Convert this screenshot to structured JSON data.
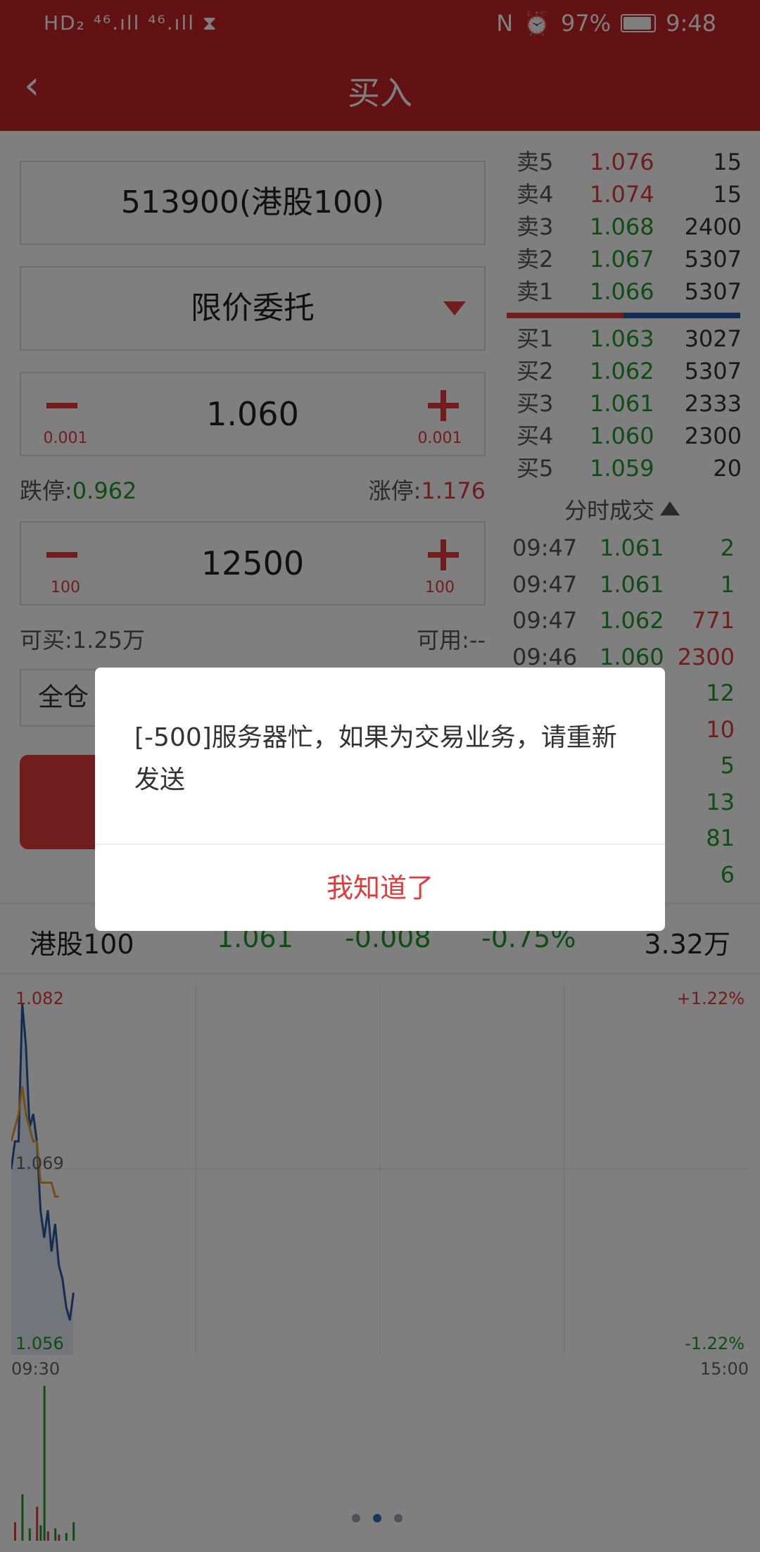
{
  "status_bar": {
    "left_indicators": "HD₂ ⁴⁶.ıll ⁴⁶.ıll ⧗",
    "nfc": "N",
    "alarm": "⏰",
    "battery_text": "97%",
    "time": "9:48"
  },
  "header": {
    "back_glyph": "‹",
    "title": "买入"
  },
  "form": {
    "stock": "513900(港股100)",
    "order_type": "限价委托",
    "price": {
      "value": "1.060",
      "step_minus": "0.001",
      "step_plus": "0.001"
    },
    "limit_down_label": "跌停:",
    "limit_down_value": "0.962",
    "limit_up_label": "涨停:",
    "limit_up_value": "1.176",
    "quantity": {
      "value": "12500",
      "step_minus": "100",
      "step_plus": "100"
    },
    "can_buy": "可买:1.25万",
    "available": "可用:--",
    "position_option": "全仓"
  },
  "order_book": {
    "asks": [
      {
        "label": "卖5",
        "price": "1.076",
        "vol": "15",
        "color": "#e23a3a"
      },
      {
        "label": "卖4",
        "price": "1.074",
        "vol": "15",
        "color": "#e23a3a"
      },
      {
        "label": "卖3",
        "price": "1.068",
        "vol": "2400",
        "color": "#1f9a2a"
      },
      {
        "label": "卖2",
        "price": "1.067",
        "vol": "5307",
        "color": "#1f9a2a"
      },
      {
        "label": "卖1",
        "price": "1.066",
        "vol": "5307",
        "color": "#1f9a2a"
      }
    ],
    "bids": [
      {
        "label": "买1",
        "price": "1.063",
        "vol": "3027",
        "color": "#1f9a2a"
      },
      {
        "label": "买2",
        "price": "1.062",
        "vol": "5307",
        "color": "#1f9a2a"
      },
      {
        "label": "买3",
        "price": "1.061",
        "vol": "2333",
        "color": "#1f9a2a"
      },
      {
        "label": "买4",
        "price": "1.060",
        "vol": "2300",
        "color": "#1f9a2a"
      },
      {
        "label": "买5",
        "price": "1.059",
        "vol": "20",
        "color": "#1f9a2a"
      }
    ]
  },
  "ticks": {
    "title": "分时成交",
    "rows": [
      {
        "time": "09:47",
        "price": "1.061",
        "vol": "2",
        "vol_color": "#1f9a2a"
      },
      {
        "time": "09:47",
        "price": "1.061",
        "vol": "1",
        "vol_color": "#1f9a2a"
      },
      {
        "time": "09:47",
        "price": "1.062",
        "vol": "771",
        "vol_color": "#e23a3a"
      },
      {
        "time": "09:46",
        "price": "1.060",
        "vol": "2300",
        "vol_color": "#e23a3a"
      },
      {
        "time": "",
        "price": "",
        "vol": "12",
        "vol_color": "#1f9a2a"
      },
      {
        "time": "",
        "price": "",
        "vol": "10",
        "vol_color": "#e23a3a"
      },
      {
        "time": "",
        "price": "",
        "vol": "5",
        "vol_color": "#1f9a2a"
      },
      {
        "time": "",
        "price": "",
        "vol": "13",
        "vol_color": "#1f9a2a"
      },
      {
        "time": "",
        "price": "",
        "vol": "81",
        "vol_color": "#1f9a2a"
      },
      {
        "time": "",
        "price": "",
        "vol": "6",
        "vol_color": "#1f9a2a"
      }
    ]
  },
  "quote": {
    "name": "港股100",
    "price": "1.061",
    "change": "-0.008",
    "change_pct": "-0.75%",
    "amount": "3.32万"
  },
  "chart_data": {
    "type": "line",
    "x_start": "09:30",
    "x_end": "15:00",
    "y_top_label": "1.082",
    "y_mid_label": "1.069",
    "y_bottom_label": "1.056",
    "pct_top_label": "+1.22%",
    "pct_bottom_label": "-1.22%",
    "ylim": [
      1.056,
      1.082
    ],
    "series": [
      {
        "values": [
          1.069,
          1.071,
          1.071,
          1.081,
          1.078,
          1.072,
          1.073,
          1.071,
          1.066,
          1.064,
          1.066,
          1.063,
          1.065,
          1.062,
          1.061,
          1.059,
          1.058,
          1.06
        ]
      },
      {
        "values": [
          1.071,
          1.072,
          1.073,
          1.075,
          1.073,
          1.072,
          1.071,
          1.071,
          1.068,
          1.068,
          1.068,
          1.068,
          1.067,
          1.067
        ]
      }
    ],
    "volume": [
      12,
      0,
      30,
      0,
      8,
      0,
      22,
      10,
      100,
      6,
      0,
      8,
      4,
      0,
      5,
      0,
      12,
      0
    ]
  },
  "pager": {
    "count": 3,
    "active": 1
  },
  "dialog": {
    "message": "[-500]服务器忙，如果为交易业务，请重新发送",
    "ok_label": "我知道了"
  }
}
